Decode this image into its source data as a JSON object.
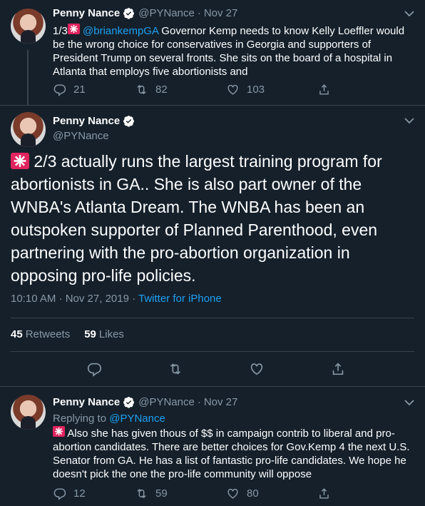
{
  "tweet1": {
    "name": "Penny Nance",
    "handle": "@PYNance",
    "dot": "·",
    "date": "Nov 27",
    "text_prefix": "1/3",
    "mention": "@briankempGA",
    "text": " Governor Kemp needs to know Kelly Loeffler would be the wrong choice for conservatives in Georgia and supporters of President Trump on several fronts. She sits on the board of a hospital in Atlanta that employs five abortionists and",
    "replies": "21",
    "retweets": "82",
    "likes": "103"
  },
  "tweet2": {
    "name": "Penny Nance",
    "handle": "@PYNance",
    "text": " 2/3 actually runs the largest training program for abortionists in GA.. She is also part owner of the WNBA's Atlanta Dream. The WNBA has been an outspoken supporter of Planned Parenthood, even partnering with the pro-abortion organization in opposing pro-life policies.",
    "timestamp": "10:10 AM · Nov 27, 2019 · ",
    "source": "Twitter for iPhone",
    "retweets_count": "45",
    "retweets_label": "Retweets",
    "likes_count": "59",
    "likes_label": "Likes"
  },
  "tweet3": {
    "name": "Penny Nance",
    "handle": "@PYNance",
    "dot": "·",
    "date": "Nov 27",
    "replying_label": "Replying to ",
    "replying_handle": "@PYNance",
    "text": " Also she has given thous of $$ in campaign contrib to liberal and pro-abortion candidates. There are better choices for Gov.Kemp 4 the next U.S. Senator from GA. He has a list of fantastic pro-life candidates.  We hope he doesn't pick the one the pro-life community will oppose",
    "replies": "12",
    "retweets": "59",
    "likes": "80"
  },
  "colors": {
    "background": "#15202b",
    "accent": "#1da1f2",
    "muted": "#8899a6",
    "divider": "#38444d",
    "siren": "#e0245e"
  },
  "icons": [
    "verified-badge-icon",
    "chevron-down-icon",
    "reply-icon",
    "retweet-icon",
    "like-icon",
    "share-icon",
    "siren-emoji"
  ]
}
